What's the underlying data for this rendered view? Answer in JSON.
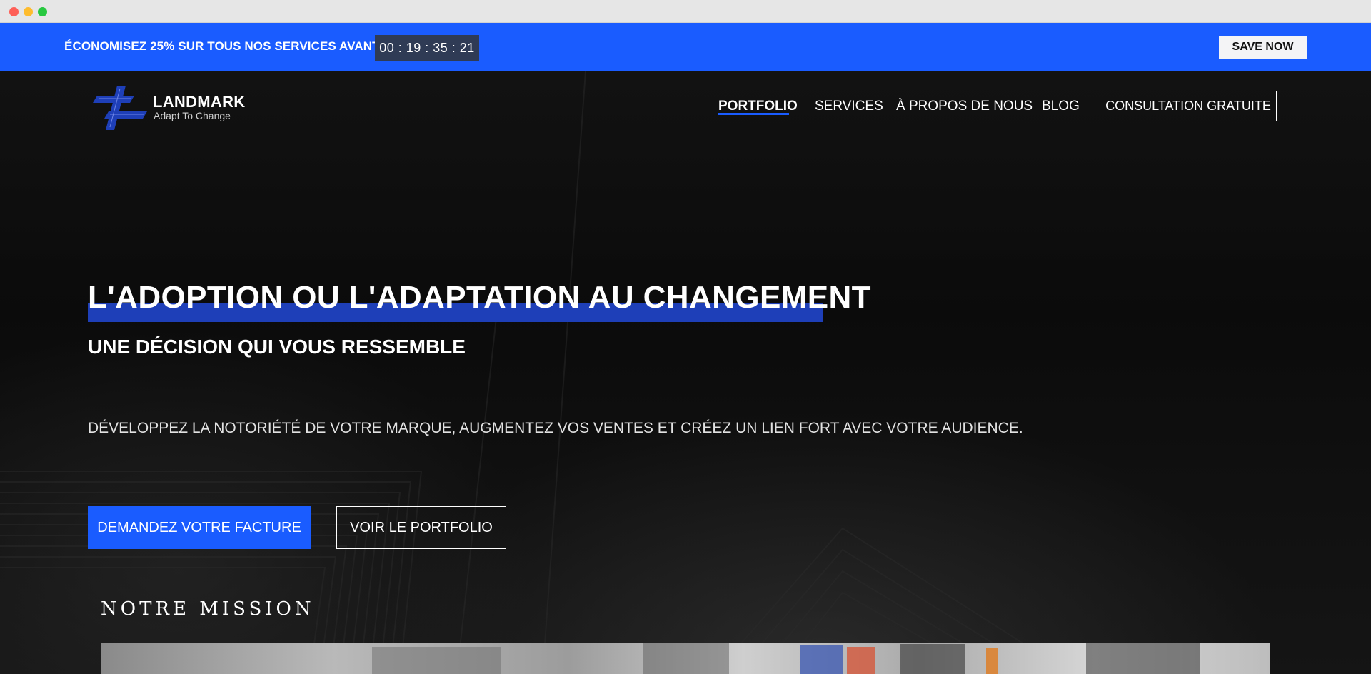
{
  "promo": {
    "text": "ÉCONOMISEZ 25% SUR TOUS NOS SERVICES AVANT LE",
    "countdown": "00 : 19 : 35 : 21",
    "button_label": "SAVE NOW",
    "background_color": "#1a5cff"
  },
  "logo": {
    "name": "LANDMARK",
    "tagline": "Adapt To Change"
  },
  "nav": {
    "items": [
      {
        "label": "PORTFOLIO",
        "active": true
      },
      {
        "label": "SERVICES",
        "active": false
      },
      {
        "label": "À PROPOS DE NOUS",
        "active": false
      },
      {
        "label": "BLOG",
        "active": false
      }
    ],
    "cta_label": "CONSULTATION GRATUITE"
  },
  "hero": {
    "headline": "L'ADOPTION OU L'ADAPTATION AU CHANGEMENT",
    "subheadline": "UNE DÉCISION QUI VOUS RESSEMBLE",
    "description": "DÉVELOPPEZ LA NOTORIÉTÉ DE VOTRE MARQUE, AUGMENTEZ VOS VENTES ET CRÉEZ UN LIEN FORT AVEC VOTRE AUDIENCE.",
    "primary_button": "DEMANDEZ VOTRE FACTURE",
    "secondary_button": "VOIR LE PORTFOLIO",
    "accent_color": "#1a5cff"
  },
  "mission": {
    "title": "NOTRE MISSION"
  }
}
